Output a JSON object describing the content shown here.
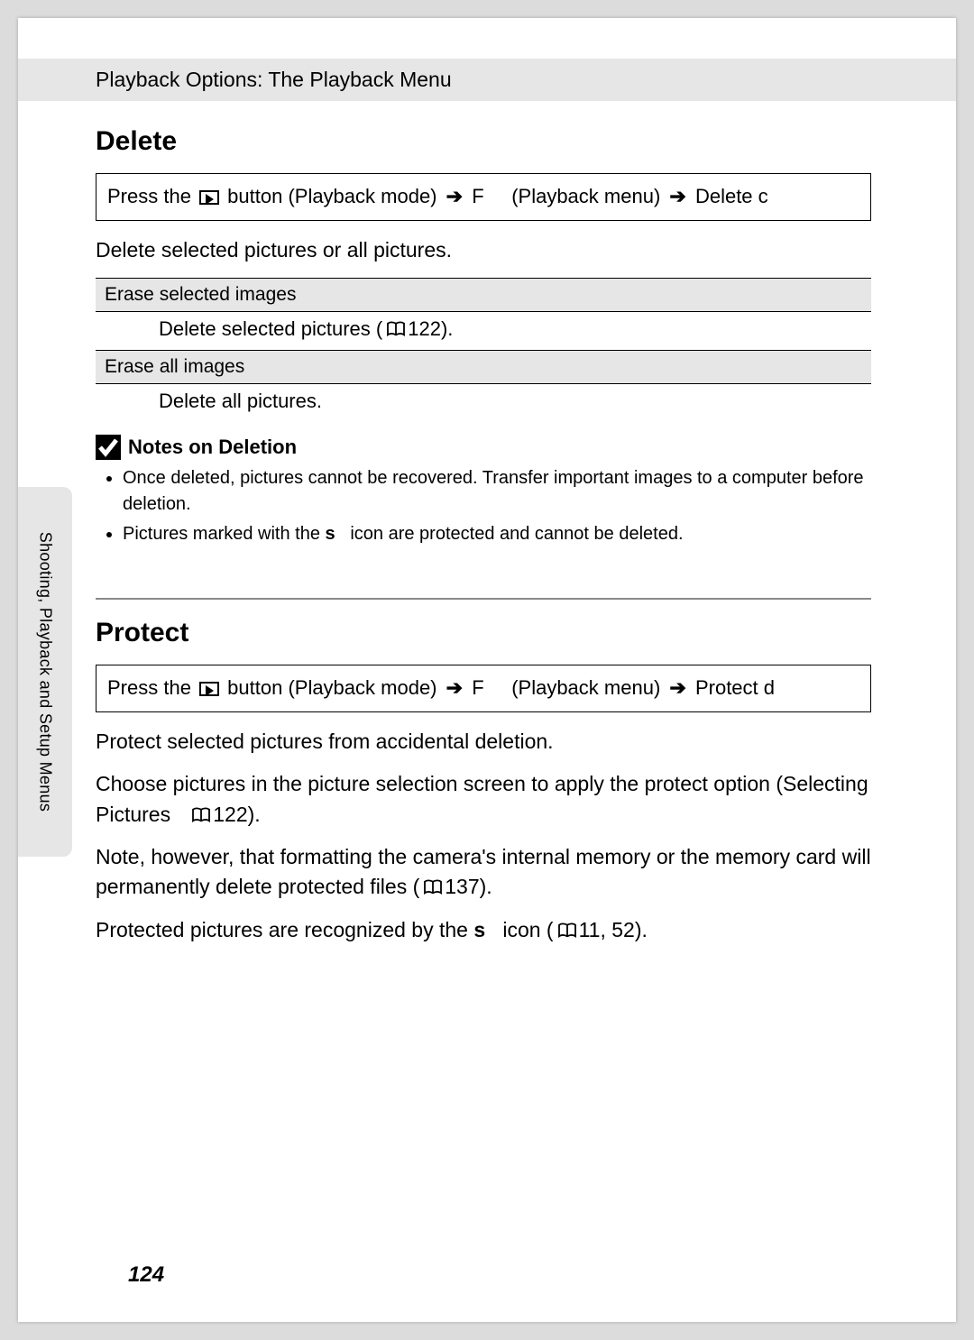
{
  "header": {
    "title": "Playback Options: The Playback Menu"
  },
  "sidebar": {
    "label": "Shooting, Playback and Setup Menus"
  },
  "page_number": "124",
  "arrow": "➔",
  "sections": {
    "delete": {
      "heading": "Delete",
      "nav": {
        "prefix": "Press the ",
        "button_text": " button (Playback mode) ",
        "f_label": "F",
        "menu_label": "(Playback menu) ",
        "action": "Delete ",
        "suffix_glyph": "c"
      },
      "intro": "Delete selected pictures or all pictures.",
      "options": [
        {
          "title": "Erase selected images",
          "desc_prefix": "Delete selected pictures (",
          "ref": "122",
          "desc_suffix": ")."
        },
        {
          "title": "Erase all images",
          "desc": "Delete all pictures."
        }
      ],
      "notes": {
        "title": "Notes on Deletion",
        "items": [
          "Once deleted, pictures cannot be recovered. Transfer important images to a computer before deletion.",
          "Pictures marked with the s icon are protected and cannot be deleted."
        ],
        "item2_pre": "Pictures marked with the ",
        "item2_glyph": "s",
        "item2_post": " icon are protected and cannot be deleted."
      }
    },
    "protect": {
      "heading": "Protect",
      "nav": {
        "prefix": "Press the ",
        "button_text": " button (Playback mode) ",
        "f_label": "F",
        "menu_label": "(Playback menu) ",
        "action": "Protect ",
        "suffix_glyph": "d"
      },
      "paras": {
        "p1": "Protect selected pictures from accidental deletion.",
        "p2_a": "Choose pictures in the picture selection screen to apply the protect option (Selecting Pictures ",
        "p2_ref": "122",
        "p2_b": ").",
        "p3_a": "Note, however, that formatting the camera's internal memory or the memory card will permanently delete protected files (",
        "p3_ref": "137",
        "p3_b": ").",
        "p4_a": "Protected pictures are recognized by the ",
        "p4_glyph": "s",
        "p4_b": " icon (",
        "p4_ref": "11, 52",
        "p4_c": ")."
      }
    }
  }
}
